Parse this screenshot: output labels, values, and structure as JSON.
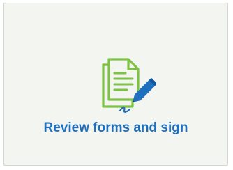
{
  "tile": {
    "label": "Review forms and sign",
    "icon": "document-sign-icon"
  },
  "colors": {
    "tile_background": "#f3f6f0",
    "tile_border": "#d4d8d0",
    "label": "#1f6fbf",
    "icon_documents": "#7dc242",
    "icon_pen": "#1f6fbf"
  }
}
